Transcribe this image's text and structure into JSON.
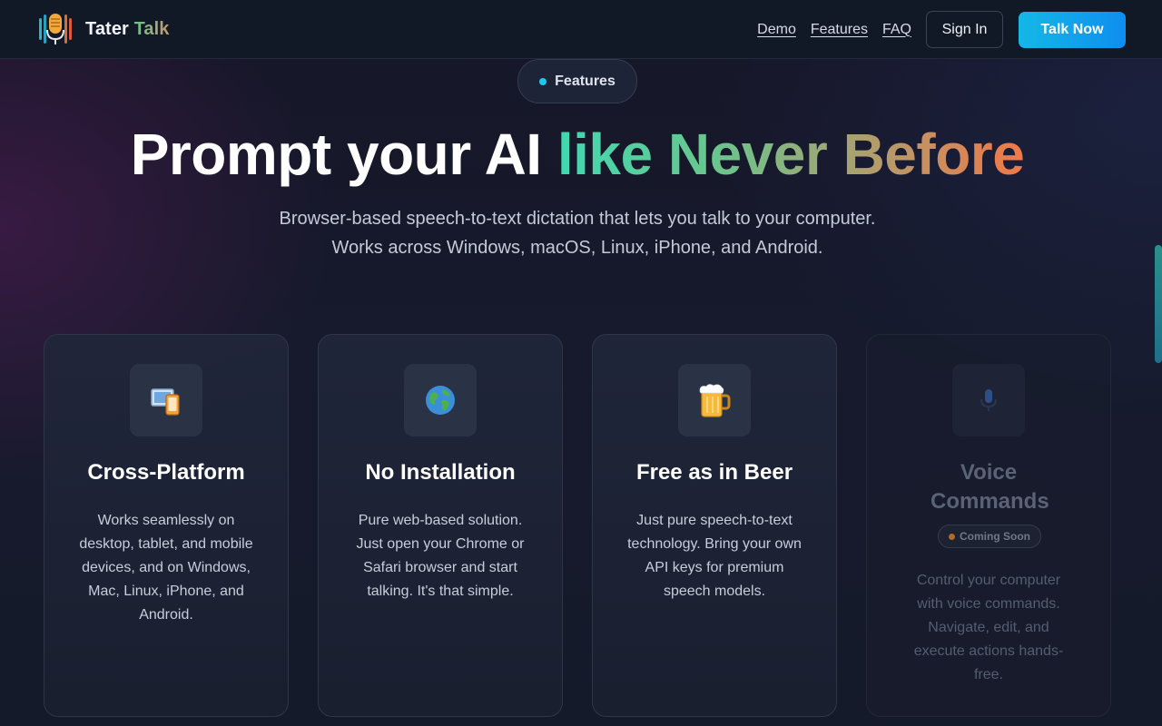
{
  "header": {
    "brand_first": "Tater",
    "brand_second": "Talk",
    "logo_icon": "microphone-logo-icon",
    "nav": [
      "Demo",
      "Features",
      "FAQ"
    ],
    "sign_in_label": "Sign In",
    "talk_now_label": "Talk Now"
  },
  "hero": {
    "pill_label": "Features",
    "headline_plain": "Prompt your AI ",
    "headline_gradient": "like Never Before",
    "subtitle_line1": "Browser-based speech-to-text dictation that lets you talk to your computer.",
    "subtitle_line2": "Works across Windows, macOS, Linux, iPhone, and Android."
  },
  "cards": [
    {
      "icon": "devices-icon",
      "title": "Cross-Platform",
      "description": "Works seamlessly on desktop, tablet, and mobile devices, and on Windows, Mac, Linux, iPhone, and Android."
    },
    {
      "icon": "globe-icon",
      "title": "No Installation",
      "description": "Pure web-based solution. Just open your Chrome or Safari browser and start talking. It's that simple."
    },
    {
      "icon": "beer-mug-icon",
      "title": "Free as in Beer",
      "description": "Just pure speech-to-text technology. Bring your own API keys for premium speech models."
    },
    {
      "icon": "microphone-icon",
      "title": "Voice Commands",
      "badge": "Coming Soon",
      "description": "Control your computer with voice commands. Navigate, edit, and execute actions hands-free."
    }
  ],
  "colors": {
    "accent_cyan": "#14b8e6",
    "accent_blue": "#0e8ef0",
    "gradient_green": "#40d9b0",
    "gradient_orange": "#f07848"
  }
}
